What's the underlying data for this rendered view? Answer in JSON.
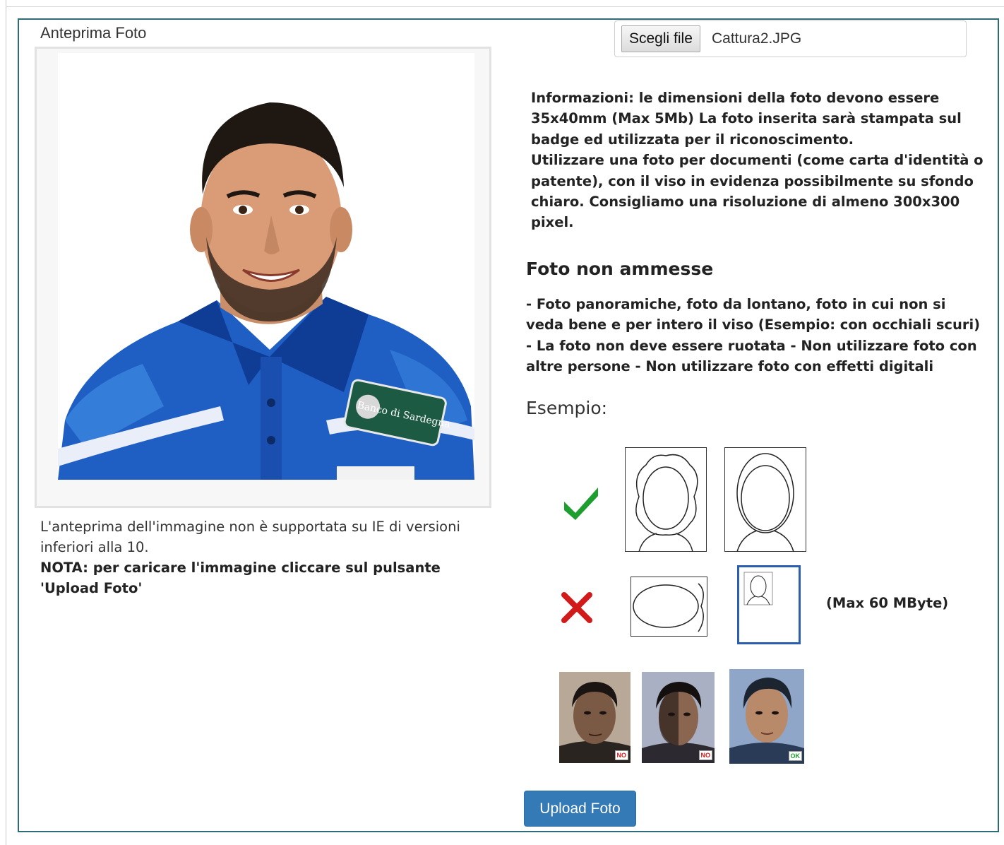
{
  "preview": {
    "title": "Anteprima Foto",
    "note_text": "L'anteprima dell'immagine non è supportata su IE di versioni inferiori alla 10.",
    "note_bold": "NOTA: per caricare l'immagine cliccare sul pulsante 'Upload Foto'",
    "photo_shirt_text": "Banco di Sardegna"
  },
  "file_input": {
    "button_label": "Scegli file",
    "file_name": "Cattura2.JPG"
  },
  "info": {
    "paragraph1": "Informazioni: le dimensioni della foto devono essere 35x40mm (Max 5Mb) La foto inserita sarà stampata sul badge ed utilizzata per il riconoscimento.",
    "paragraph2": "Utilizzare una foto per documenti (come carta d'identità o patente), con il viso in evidenza possibilmente su sfondo chiaro. Consigliamo una risoluzione di almeno 300x300 pixel."
  },
  "forbidden": {
    "heading": "Foto non ammesse",
    "text": "- Foto panoramiche, foto da lontano, foto in cui non si veda bene e per intero il viso (Esempio: con occhiali scuri) - La foto non deve essere ruotata - Non utilizzare foto con altre persone - Non utilizzare foto con effetti digitali"
  },
  "example": {
    "heading": "Esempio:",
    "max_label": "(Max 60 MByte)",
    "tags": [
      "NO",
      "NO",
      "OK"
    ],
    "icons": [
      "check-icon",
      "cross-icon"
    ],
    "colors": {
      "check": "#1e9e2e",
      "cross": "#d11a1a",
      "tag_no": "#d11a1a",
      "tag_ok": "#1e9e2e"
    }
  },
  "upload_button": {
    "label": "Upload Foto",
    "color": "#337ab7"
  }
}
